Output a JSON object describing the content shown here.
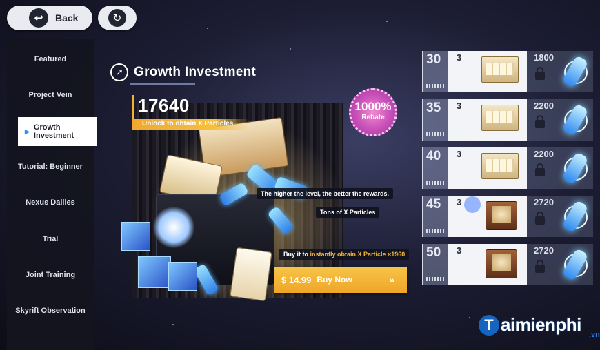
{
  "top_bar": {
    "back_label": "Back",
    "back_icon": "back-arrow-icon",
    "refresh_icon": "refresh-icon"
  },
  "sidebar": {
    "items": [
      {
        "label": "Featured",
        "active": false
      },
      {
        "label": "Project Vein",
        "active": false
      },
      {
        "label": "Growth Investment",
        "active": true
      },
      {
        "label": "Tutorial: Beginner",
        "active": false
      },
      {
        "label": "Nexus Dailies",
        "active": false
      },
      {
        "label": "Trial",
        "active": false
      },
      {
        "label": "Joint Training",
        "active": false
      },
      {
        "label": "Skyrift Observation",
        "active": false
      }
    ]
  },
  "main": {
    "title": "Growth Investment",
    "title_icon": "growth-arrow-icon",
    "amount": "17640",
    "unlock_text": "Unlock to obtain X Particles",
    "rebate_percent": "1000%",
    "rebate_label": "Rebate",
    "tag_level": "The higher the level, the better the rewards.",
    "tag_particles": "Tons of X Particles",
    "buy_hint_prefix": "Buy it to ",
    "buy_hint_highlight": "instantly obtain X Particle ×1960",
    "price": "$ 14.99",
    "buy_label": "Buy Now",
    "buy_chevron": "»",
    "accent_color": "#f4b134"
  },
  "rewards": [
    {
      "level": "30",
      "free_qty": "3",
      "free_item": "supply-crate",
      "paid_value": "1800",
      "locked": true
    },
    {
      "level": "35",
      "free_qty": "3",
      "free_item": "supply-crate",
      "paid_value": "2200",
      "locked": true
    },
    {
      "level": "40",
      "free_qty": "3",
      "free_item": "supply-crate",
      "paid_value": "2200",
      "locked": true
    },
    {
      "level": "45",
      "free_qty": "3",
      "free_item": "supply-chest",
      "paid_value": "2720",
      "locked": true
    },
    {
      "level": "50",
      "free_qty": "3",
      "free_item": "supply-chest",
      "paid_value": "2720",
      "locked": true
    }
  ],
  "watermark": {
    "brand_initial": "T",
    "brand_text": "aimienphi",
    "brand_suffix": ".vn"
  }
}
